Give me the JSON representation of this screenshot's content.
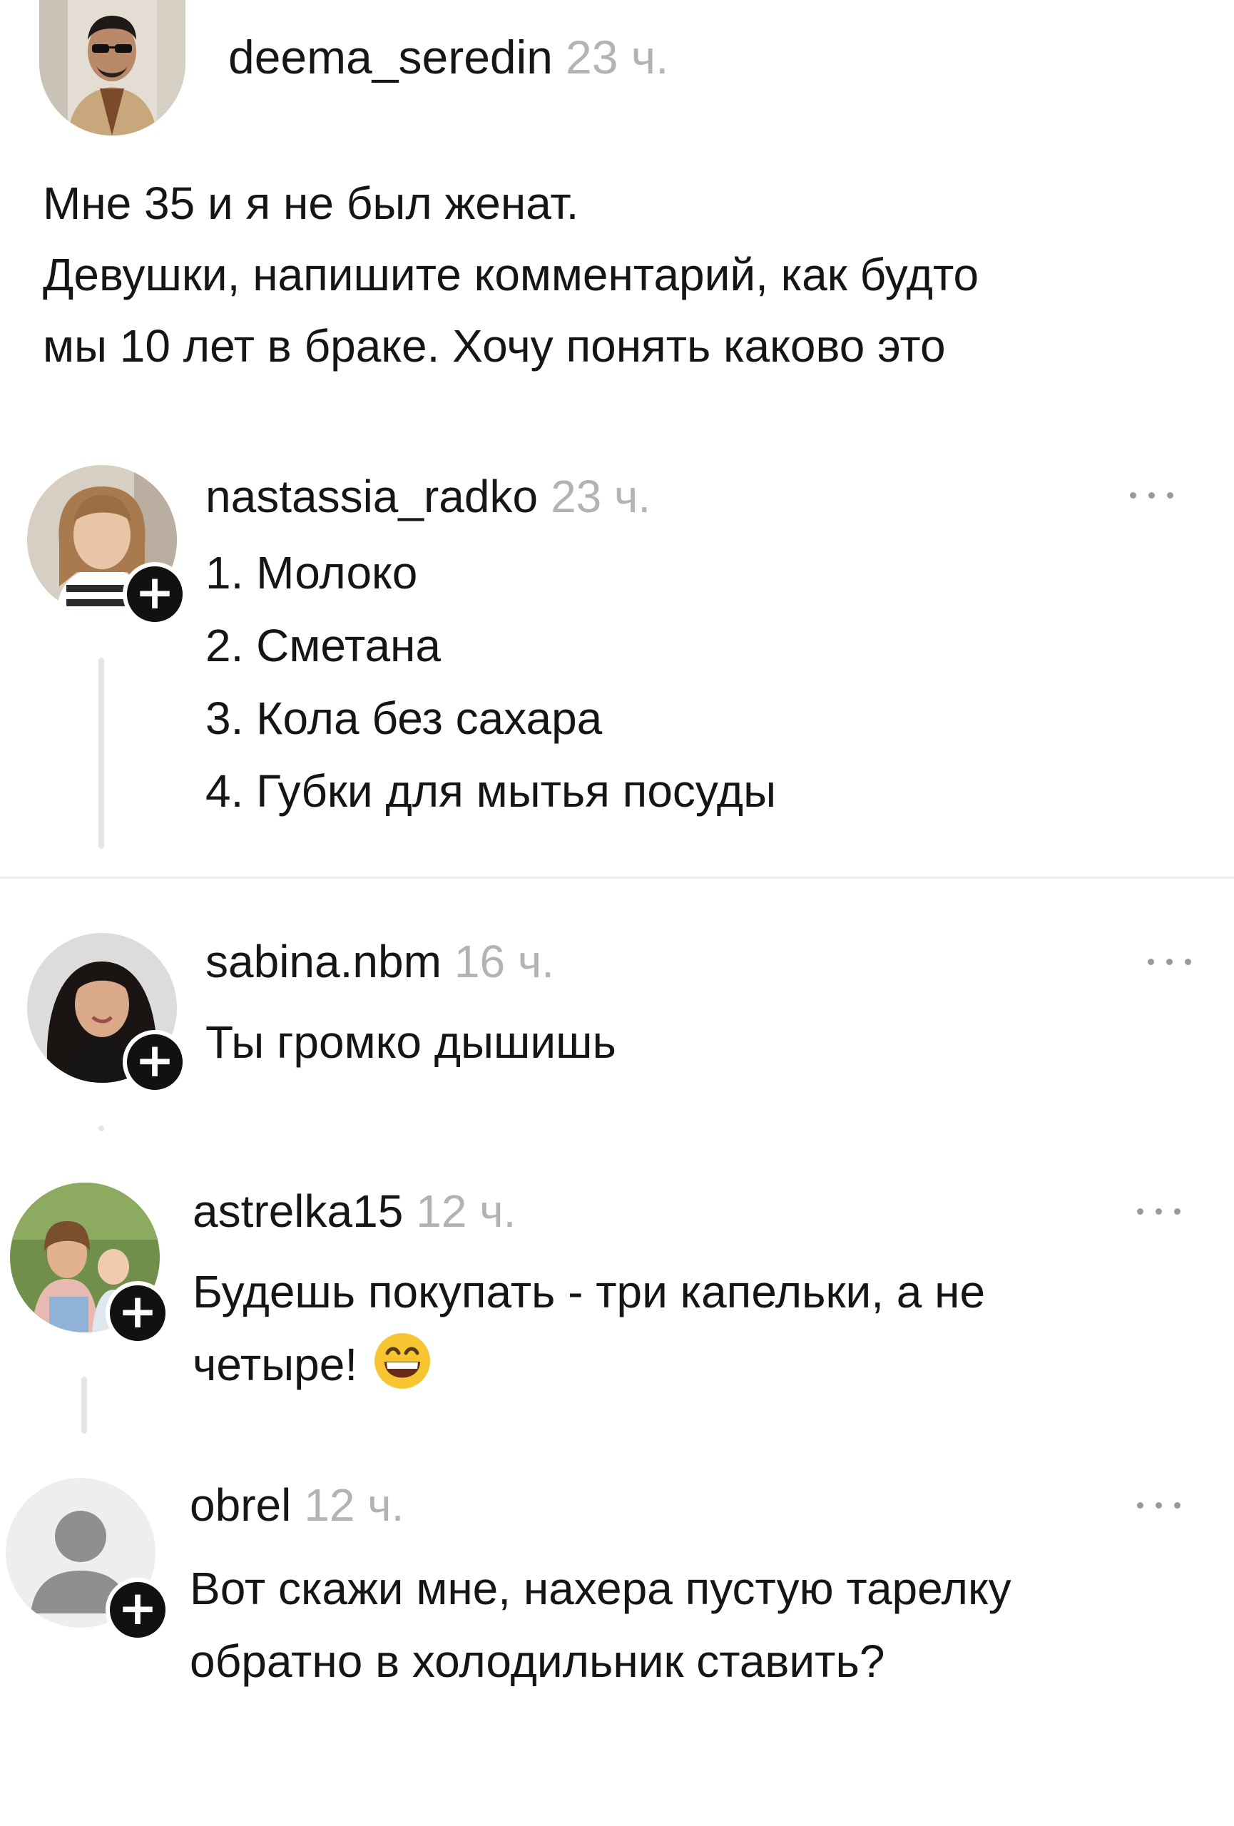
{
  "post": {
    "author": "deema_seredin",
    "time": "23 ч.",
    "lines": [
      "Мне 35 и я не был женат.",
      "Девушки, напишите комментарий, как будто",
      "мы 10 лет в браке. Хочу понять каково это"
    ]
  },
  "comments": [
    {
      "author": "nastassia_radko",
      "time": "23 ч.",
      "lines": [
        "1. Молоко",
        "2. Сметана",
        "3. Кола без сахара",
        "4. Губки для мытья посуды"
      ]
    },
    {
      "author": "sabina.nbm",
      "time": "16 ч.",
      "lines": [
        "Ты громко дышишь"
      ]
    },
    {
      "author": "astrelka15",
      "time": "12 ч.",
      "lines": [
        "Будешь покупать - три капельки, а не",
        "четыре!"
      ],
      "emoji": "grinning-face-with-smiling-eyes-emoji"
    },
    {
      "author": "obrel",
      "time": "12 ч.",
      "lines": [
        "Вот скажи мне, нахера пустую тарелку",
        "обратно в холодильник ставить?"
      ]
    }
  ],
  "icons": {
    "follow": "plus-icon",
    "more": "more-options-icon",
    "default_avatar": "default-avatar-icon"
  },
  "colors": {
    "text": "#151515",
    "time": "#b3b3b3",
    "follow_badge": "#111111",
    "thread_line": "#e4e4e4"
  }
}
